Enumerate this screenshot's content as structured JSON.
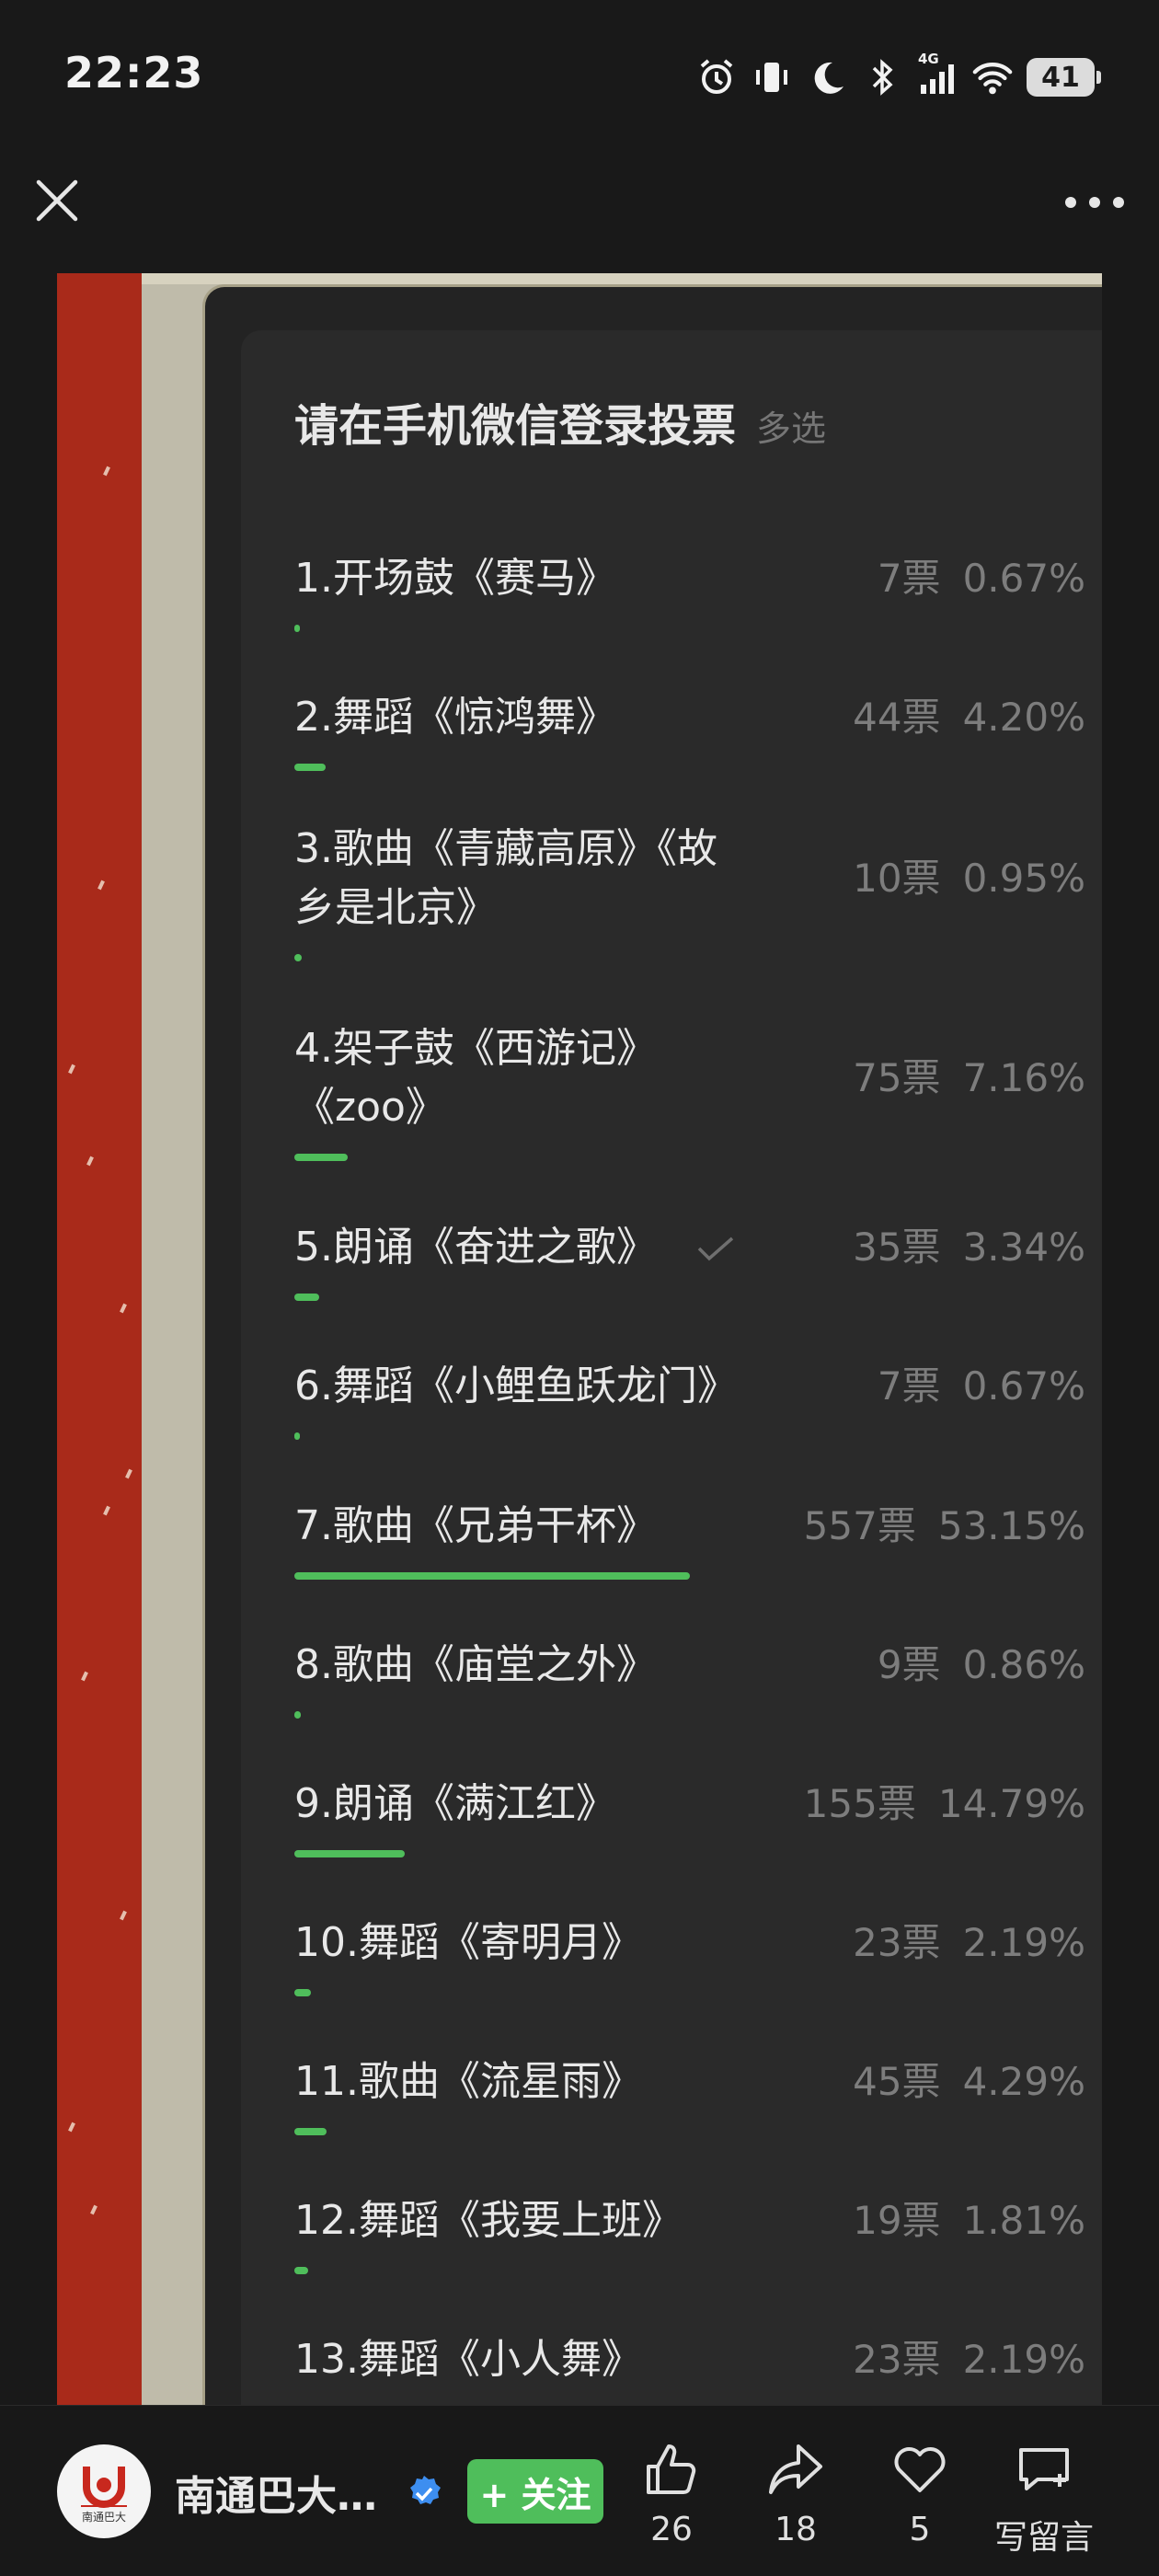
{
  "status_bar": {
    "time": "22:23",
    "network": "4G",
    "battery": "41"
  },
  "vote": {
    "title": "请在手机微信登录投票",
    "multi_label": "多选",
    "accent_color": "#4fbe5b",
    "options": [
      {
        "label": "1.开场鼓《赛马》",
        "votes": "7票",
        "percent": "0.67%",
        "share": 0.0067,
        "checked": false
      },
      {
        "label": "2.舞蹈《惊鸿舞》",
        "votes": "44票",
        "percent": "4.20%",
        "share": 0.042,
        "checked": false
      },
      {
        "label": "3.歌曲《青藏高原》《故乡是北京》",
        "votes": "10票",
        "percent": "0.95%",
        "share": 0.0095,
        "checked": false
      },
      {
        "label": "4.架子鼓《西游记》《zoo》",
        "votes": "75票",
        "percent": "7.16%",
        "share": 0.0716,
        "checked": false
      },
      {
        "label": "5.朗诵《奋进之歌》",
        "votes": "35票",
        "percent": "3.34%",
        "share": 0.0334,
        "checked": true
      },
      {
        "label": "6.舞蹈《小鲤鱼跃龙门》",
        "votes": "7票",
        "percent": "0.67%",
        "share": 0.0067,
        "checked": false
      },
      {
        "label": "7.歌曲《兄弟干杯》",
        "votes": "557票",
        "percent": "53.15%",
        "share": 0.5315,
        "checked": false
      },
      {
        "label": "8.歌曲《庙堂之外》",
        "votes": "9票",
        "percent": "0.86%",
        "share": 0.0086,
        "checked": false
      },
      {
        "label": "9.朗诵《满江红》",
        "votes": "155票",
        "percent": "14.79%",
        "share": 0.1479,
        "checked": false
      },
      {
        "label": "10.舞蹈《寄明月》",
        "votes": "23票",
        "percent": "2.19%",
        "share": 0.0219,
        "checked": false
      },
      {
        "label": "11.歌曲《流星雨》",
        "votes": "45票",
        "percent": "4.29%",
        "share": 0.0429,
        "checked": false
      },
      {
        "label": "12.舞蹈《我要上班》",
        "votes": "19票",
        "percent": "1.81%",
        "share": 0.0181,
        "checked": false
      },
      {
        "label": "13.舞蹈《小人舞》",
        "votes": "23票",
        "percent": "2.19%",
        "share": 0.0219,
        "checked": false
      }
    ]
  },
  "bottom_bar": {
    "account_name": "南通巴大…",
    "avatar_text": "南通巴大",
    "follow_label": "+ 关注",
    "like_count": "26",
    "share_count": "18",
    "favorite_count": "5",
    "comment_label": "写留言"
  }
}
